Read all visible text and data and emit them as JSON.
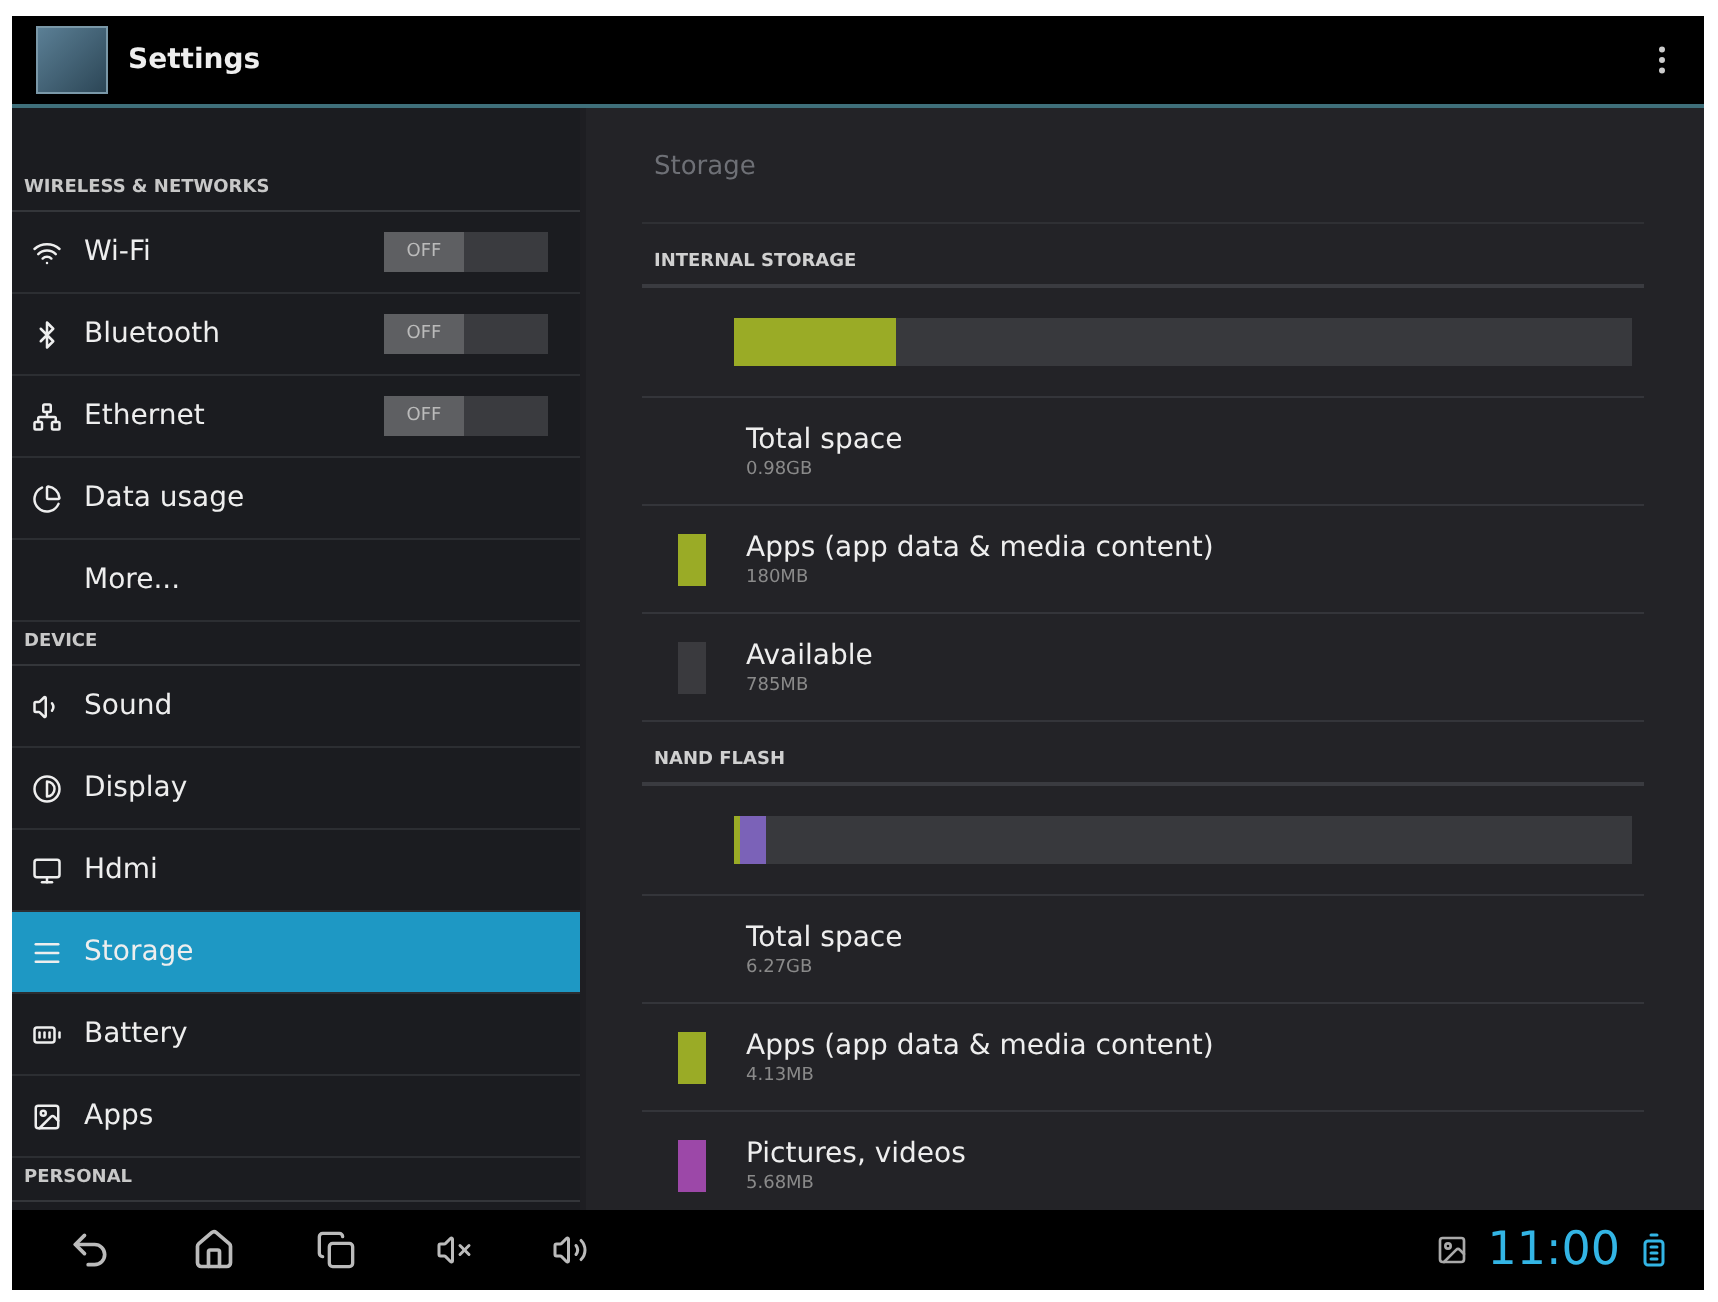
{
  "action_bar": {
    "title": "Settings"
  },
  "sidebar": {
    "sections": [
      {
        "title": "WIRELESS & NETWORKS",
        "items": [
          {
            "label": "Wi-Fi",
            "selected": false,
            "toggle": {
              "on": false,
              "label": "OFF"
            }
          },
          {
            "label": "Bluetooth",
            "selected": false,
            "toggle": {
              "on": false,
              "label": "OFF"
            }
          },
          {
            "label": "Ethernet",
            "selected": false,
            "toggle": {
              "on": false,
              "label": "OFF"
            }
          },
          {
            "label": "Data usage",
            "selected": false
          },
          {
            "label": "More...",
            "selected": false
          }
        ]
      },
      {
        "title": "DEVICE",
        "items": [
          {
            "label": "Sound",
            "selected": false
          },
          {
            "label": "Display",
            "selected": false
          },
          {
            "label": "Hdmi",
            "selected": false
          },
          {
            "label": "Storage",
            "selected": true
          },
          {
            "label": "Battery",
            "selected": false
          },
          {
            "label": "Apps",
            "selected": false
          }
        ]
      },
      {
        "title": "PERSONAL"
      }
    ]
  },
  "content": {
    "title": "Storage",
    "sections": [
      {
        "title": "INTERNAL STORAGE",
        "bar": [
          {
            "level": 0.18,
            "color": "#9aab26"
          }
        ],
        "rows": [
          {
            "kind": "total",
            "label": "Total space",
            "value": "0.98GB"
          },
          {
            "kind": "category",
            "label": "Apps (app data & media content)",
            "value": "180MB",
            "color": "#9aab26"
          },
          {
            "kind": "category",
            "label": "Available",
            "value": "785MB",
            "color": "#3a3a3e"
          }
        ]
      },
      {
        "title": "NAND FLASH",
        "bar": [
          {
            "level": 0.006,
            "color": "#9aab26"
          },
          {
            "level": 0.03,
            "color": "#7b62b8"
          }
        ],
        "rows": [
          {
            "kind": "total",
            "label": "Total space",
            "value": "6.27GB"
          },
          {
            "kind": "category",
            "label": "Apps (app data & media content)",
            "value": "4.13MB",
            "color": "#9aab26"
          },
          {
            "kind": "category",
            "label": "Pictures, videos",
            "value": "5.68MB",
            "color": "#9c48a8"
          }
        ]
      }
    ]
  },
  "nav_bar": {
    "clock": "11:00"
  }
}
